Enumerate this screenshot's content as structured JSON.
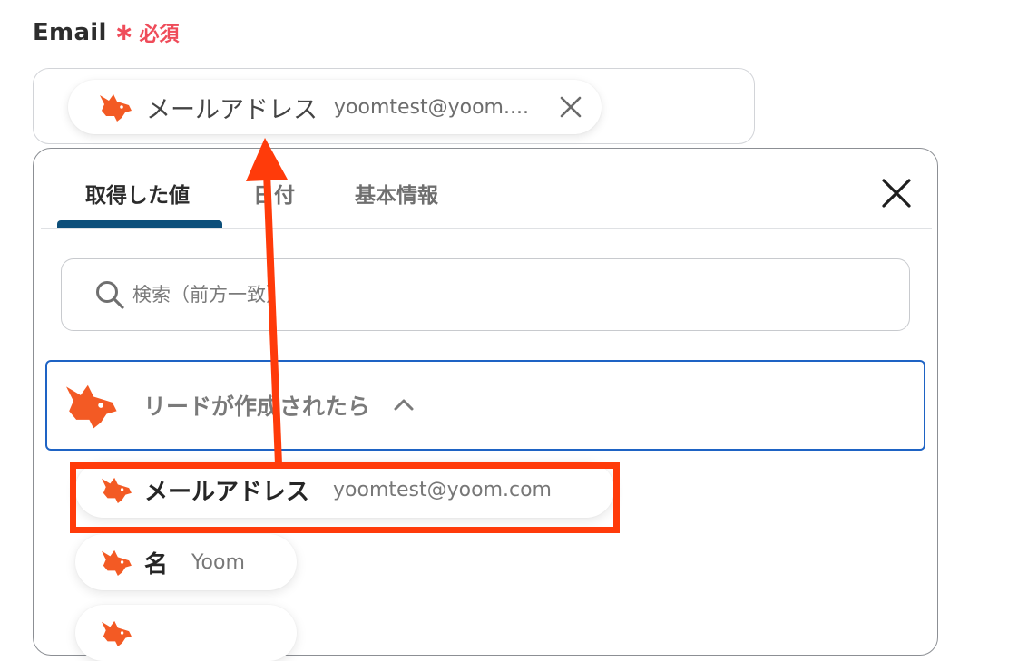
{
  "field": {
    "label": "Email",
    "required_mark": "∗",
    "required_text": "必須",
    "chip": {
      "name": "メールアドレス",
      "value": "yoomtest@yoom...."
    }
  },
  "panel": {
    "tabs": [
      {
        "label": "取得した値",
        "active": true
      },
      {
        "label": "日付",
        "active": false
      },
      {
        "label": "基本情報",
        "active": false
      }
    ],
    "search": {
      "placeholder": "検索（前方一致）",
      "value": ""
    },
    "group": {
      "label": "リードが作成されたら",
      "expanded": true
    },
    "items": [
      {
        "name": "メールアドレス",
        "value": "yoomtest@yoom.com"
      },
      {
        "name": "名",
        "value": "Yoom"
      }
    ]
  },
  "colors": {
    "accent_tab": "#0d4f7a",
    "group_border": "#1e63c4",
    "required": "#ef4c5a",
    "fox": "#f35a24",
    "annotation": "#ff3b0a"
  }
}
